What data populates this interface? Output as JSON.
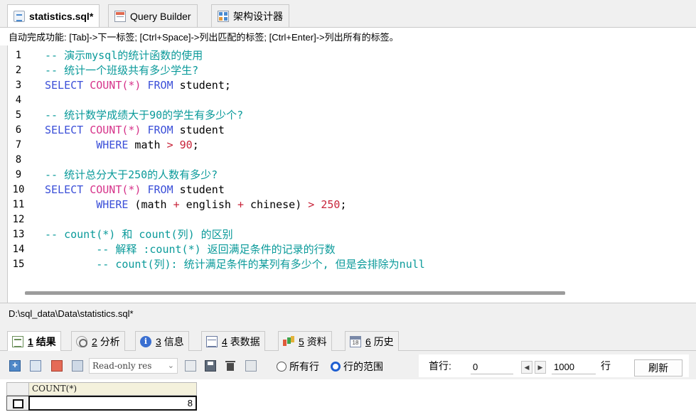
{
  "top_tabs": [
    {
      "label": "statistics.sql*",
      "icon": "sql-file-icon",
      "active": true
    },
    {
      "label": "Query Builder",
      "icon": "query-builder-icon",
      "active": false
    },
    {
      "label": "架构设计器",
      "icon": "schema-designer-icon",
      "active": false
    }
  ],
  "hint": "自动完成功能: [Tab]->下一标签; [Ctrl+Space]->列出匹配的标签; [Ctrl+Enter]->列出所有的标签。",
  "editor": {
    "line_numbers": [
      "1",
      "2",
      "3",
      "4",
      "5",
      "6",
      "7",
      "8",
      "9",
      "10",
      "11",
      "12",
      "13",
      "14",
      "15"
    ],
    "lines": [
      [
        {
          "t": "-- 演示mysql的统计函数的使用",
          "c": "comment"
        }
      ],
      [
        {
          "t": "-- 统计一个班级共有多少学生?",
          "c": "comment"
        }
      ],
      [
        {
          "t": "SELECT",
          "c": "kw"
        },
        {
          "t": " ",
          "c": "plain"
        },
        {
          "t": "COUNT(*)",
          "c": "fn"
        },
        {
          "t": " ",
          "c": "plain"
        },
        {
          "t": "FROM",
          "c": "kw"
        },
        {
          "t": " student;",
          "c": "plain"
        }
      ],
      [],
      [
        {
          "t": "-- 统计数学成绩大于90的学生有多少个?",
          "c": "comment"
        }
      ],
      [
        {
          "t": "SELECT",
          "c": "kw"
        },
        {
          "t": " ",
          "c": "plain"
        },
        {
          "t": "COUNT(*)",
          "c": "fn"
        },
        {
          "t": " ",
          "c": "plain"
        },
        {
          "t": "FROM",
          "c": "kw"
        },
        {
          "t": " student",
          "c": "plain"
        }
      ],
      [
        {
          "t": "        ",
          "c": "plain"
        },
        {
          "t": "WHERE",
          "c": "kw"
        },
        {
          "t": " math ",
          "c": "plain"
        },
        {
          "t": ">",
          "c": "op"
        },
        {
          "t": " ",
          "c": "plain"
        },
        {
          "t": "90",
          "c": "num"
        },
        {
          "t": ";",
          "c": "plain"
        }
      ],
      [],
      [
        {
          "t": "-- 统计总分大于250的人数有多少?",
          "c": "comment"
        }
      ],
      [
        {
          "t": "SELECT",
          "c": "kw"
        },
        {
          "t": " ",
          "c": "plain"
        },
        {
          "t": "COUNT(*)",
          "c": "fn"
        },
        {
          "t": " ",
          "c": "plain"
        },
        {
          "t": "FROM",
          "c": "kw"
        },
        {
          "t": " student",
          "c": "plain"
        }
      ],
      [
        {
          "t": "        ",
          "c": "plain"
        },
        {
          "t": "WHERE",
          "c": "kw"
        },
        {
          "t": " (math ",
          "c": "plain"
        },
        {
          "t": "+",
          "c": "op"
        },
        {
          "t": " english ",
          "c": "plain"
        },
        {
          "t": "+",
          "c": "op"
        },
        {
          "t": " chinese) ",
          "c": "plain"
        },
        {
          "t": ">",
          "c": "op"
        },
        {
          "t": " ",
          "c": "plain"
        },
        {
          "t": "250",
          "c": "num"
        },
        {
          "t": ";",
          "c": "plain"
        }
      ],
      [],
      [
        {
          "t": "-- count(*) 和 count(列) 的区别",
          "c": "comment"
        }
      ],
      [
        {
          "t": "        -- 解释 :count(*) 返回满足条件的记录的行数",
          "c": "comment"
        }
      ],
      [
        {
          "t": "        -- count(列): 统计满足条件的某列有多少个, 但是会排除为null",
          "c": "comment"
        }
      ]
    ]
  },
  "path": "D:\\sql_data\\Data\\statistics.sql*",
  "result_tabs": [
    {
      "num": "1",
      "label": "结果",
      "icon": "grid-icon",
      "active": true
    },
    {
      "num": "2",
      "label": "分析",
      "icon": "analyze-icon",
      "active": false
    },
    {
      "num": "3",
      "label": "信息",
      "icon": "info-icon",
      "active": false
    },
    {
      "num": "4",
      "label": "表数据",
      "icon": "table-icon",
      "active": false
    },
    {
      "num": "5",
      "label": "资料",
      "icon": "profile-icon",
      "active": false
    },
    {
      "num": "6",
      "label": "历史",
      "icon": "calendar-icon",
      "active": false
    }
  ],
  "toolbar": {
    "readonly_value": "Read-only res",
    "radio_all_rows": "所有行",
    "radio_range": "行的范围",
    "first_row_label": "首行:",
    "first_row_value": "0",
    "prev_glyph": "◀",
    "next_glyph": "▶",
    "count_value": "1000",
    "rows_unit": "行",
    "refresh": "刷新"
  },
  "result_grid": {
    "column": "COUNT(*)",
    "rows": [
      [
        "8"
      ]
    ]
  }
}
